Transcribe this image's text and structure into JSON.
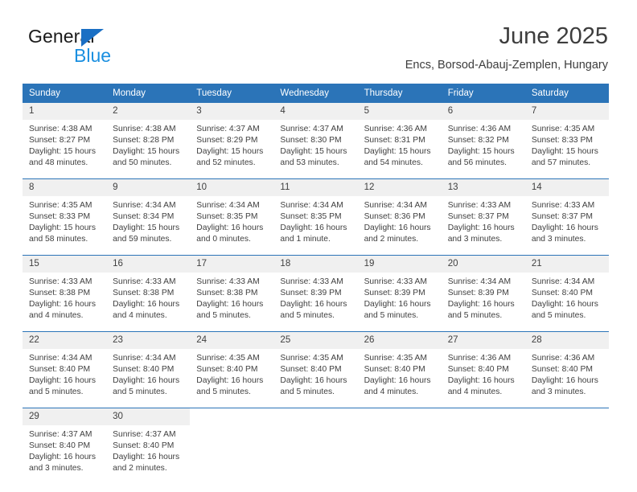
{
  "logo": {
    "text_top": "General",
    "text_bottom": "Blue",
    "triangle_color": "#1a6fc4",
    "blue_color": "#1a8fe0"
  },
  "header": {
    "title": "June 2025",
    "subtitle": "Encs, Borsod-Abauj-Zemplen, Hungary"
  },
  "theme": {
    "header_bg": "#2b74b8",
    "daynum_bg": "#f0f0f0",
    "text": "#404040"
  },
  "calendar": {
    "weekday_headers": [
      "Sunday",
      "Monday",
      "Tuesday",
      "Wednesday",
      "Thursday",
      "Friday",
      "Saturday"
    ],
    "weeks": [
      [
        {
          "day": "1",
          "sunrise": "Sunrise: 4:38 AM",
          "sunset": "Sunset: 8:27 PM",
          "daylight_line1": "Daylight: 15 hours",
          "daylight_line2": "and 48 minutes."
        },
        {
          "day": "2",
          "sunrise": "Sunrise: 4:38 AM",
          "sunset": "Sunset: 8:28 PM",
          "daylight_line1": "Daylight: 15 hours",
          "daylight_line2": "and 50 minutes."
        },
        {
          "day": "3",
          "sunrise": "Sunrise: 4:37 AM",
          "sunset": "Sunset: 8:29 PM",
          "daylight_line1": "Daylight: 15 hours",
          "daylight_line2": "and 52 minutes."
        },
        {
          "day": "4",
          "sunrise": "Sunrise: 4:37 AM",
          "sunset": "Sunset: 8:30 PM",
          "daylight_line1": "Daylight: 15 hours",
          "daylight_line2": "and 53 minutes."
        },
        {
          "day": "5",
          "sunrise": "Sunrise: 4:36 AM",
          "sunset": "Sunset: 8:31 PM",
          "daylight_line1": "Daylight: 15 hours",
          "daylight_line2": "and 54 minutes."
        },
        {
          "day": "6",
          "sunrise": "Sunrise: 4:36 AM",
          "sunset": "Sunset: 8:32 PM",
          "daylight_line1": "Daylight: 15 hours",
          "daylight_line2": "and 56 minutes."
        },
        {
          "day": "7",
          "sunrise": "Sunrise: 4:35 AM",
          "sunset": "Sunset: 8:33 PM",
          "daylight_line1": "Daylight: 15 hours",
          "daylight_line2": "and 57 minutes."
        }
      ],
      [
        {
          "day": "8",
          "sunrise": "Sunrise: 4:35 AM",
          "sunset": "Sunset: 8:33 PM",
          "daylight_line1": "Daylight: 15 hours",
          "daylight_line2": "and 58 minutes."
        },
        {
          "day": "9",
          "sunrise": "Sunrise: 4:34 AM",
          "sunset": "Sunset: 8:34 PM",
          "daylight_line1": "Daylight: 15 hours",
          "daylight_line2": "and 59 minutes."
        },
        {
          "day": "10",
          "sunrise": "Sunrise: 4:34 AM",
          "sunset": "Sunset: 8:35 PM",
          "daylight_line1": "Daylight: 16 hours",
          "daylight_line2": "and 0 minutes."
        },
        {
          "day": "11",
          "sunrise": "Sunrise: 4:34 AM",
          "sunset": "Sunset: 8:35 PM",
          "daylight_line1": "Daylight: 16 hours",
          "daylight_line2": "and 1 minute."
        },
        {
          "day": "12",
          "sunrise": "Sunrise: 4:34 AM",
          "sunset": "Sunset: 8:36 PM",
          "daylight_line1": "Daylight: 16 hours",
          "daylight_line2": "and 2 minutes."
        },
        {
          "day": "13",
          "sunrise": "Sunrise: 4:33 AM",
          "sunset": "Sunset: 8:37 PM",
          "daylight_line1": "Daylight: 16 hours",
          "daylight_line2": "and 3 minutes."
        },
        {
          "day": "14",
          "sunrise": "Sunrise: 4:33 AM",
          "sunset": "Sunset: 8:37 PM",
          "daylight_line1": "Daylight: 16 hours",
          "daylight_line2": "and 3 minutes."
        }
      ],
      [
        {
          "day": "15",
          "sunrise": "Sunrise: 4:33 AM",
          "sunset": "Sunset: 8:38 PM",
          "daylight_line1": "Daylight: 16 hours",
          "daylight_line2": "and 4 minutes."
        },
        {
          "day": "16",
          "sunrise": "Sunrise: 4:33 AM",
          "sunset": "Sunset: 8:38 PM",
          "daylight_line1": "Daylight: 16 hours",
          "daylight_line2": "and 4 minutes."
        },
        {
          "day": "17",
          "sunrise": "Sunrise: 4:33 AM",
          "sunset": "Sunset: 8:38 PM",
          "daylight_line1": "Daylight: 16 hours",
          "daylight_line2": "and 5 minutes."
        },
        {
          "day": "18",
          "sunrise": "Sunrise: 4:33 AM",
          "sunset": "Sunset: 8:39 PM",
          "daylight_line1": "Daylight: 16 hours",
          "daylight_line2": "and 5 minutes."
        },
        {
          "day": "19",
          "sunrise": "Sunrise: 4:33 AM",
          "sunset": "Sunset: 8:39 PM",
          "daylight_line1": "Daylight: 16 hours",
          "daylight_line2": "and 5 minutes."
        },
        {
          "day": "20",
          "sunrise": "Sunrise: 4:34 AM",
          "sunset": "Sunset: 8:39 PM",
          "daylight_line1": "Daylight: 16 hours",
          "daylight_line2": "and 5 minutes."
        },
        {
          "day": "21",
          "sunrise": "Sunrise: 4:34 AM",
          "sunset": "Sunset: 8:40 PM",
          "daylight_line1": "Daylight: 16 hours",
          "daylight_line2": "and 5 minutes."
        }
      ],
      [
        {
          "day": "22",
          "sunrise": "Sunrise: 4:34 AM",
          "sunset": "Sunset: 8:40 PM",
          "daylight_line1": "Daylight: 16 hours",
          "daylight_line2": "and 5 minutes."
        },
        {
          "day": "23",
          "sunrise": "Sunrise: 4:34 AM",
          "sunset": "Sunset: 8:40 PM",
          "daylight_line1": "Daylight: 16 hours",
          "daylight_line2": "and 5 minutes."
        },
        {
          "day": "24",
          "sunrise": "Sunrise: 4:35 AM",
          "sunset": "Sunset: 8:40 PM",
          "daylight_line1": "Daylight: 16 hours",
          "daylight_line2": "and 5 minutes."
        },
        {
          "day": "25",
          "sunrise": "Sunrise: 4:35 AM",
          "sunset": "Sunset: 8:40 PM",
          "daylight_line1": "Daylight: 16 hours",
          "daylight_line2": "and 5 minutes."
        },
        {
          "day": "26",
          "sunrise": "Sunrise: 4:35 AM",
          "sunset": "Sunset: 8:40 PM",
          "daylight_line1": "Daylight: 16 hours",
          "daylight_line2": "and 4 minutes."
        },
        {
          "day": "27",
          "sunrise": "Sunrise: 4:36 AM",
          "sunset": "Sunset: 8:40 PM",
          "daylight_line1": "Daylight: 16 hours",
          "daylight_line2": "and 4 minutes."
        },
        {
          "day": "28",
          "sunrise": "Sunrise: 4:36 AM",
          "sunset": "Sunset: 8:40 PM",
          "daylight_line1": "Daylight: 16 hours",
          "daylight_line2": "and 3 minutes."
        }
      ],
      [
        {
          "day": "29",
          "sunrise": "Sunrise: 4:37 AM",
          "sunset": "Sunset: 8:40 PM",
          "daylight_line1": "Daylight: 16 hours",
          "daylight_line2": "and 3 minutes."
        },
        {
          "day": "30",
          "sunrise": "Sunrise: 4:37 AM",
          "sunset": "Sunset: 8:40 PM",
          "daylight_line1": "Daylight: 16 hours",
          "daylight_line2": "and 2 minutes."
        },
        {
          "day": "",
          "sunrise": "",
          "sunset": "",
          "daylight_line1": "",
          "daylight_line2": ""
        },
        {
          "day": "",
          "sunrise": "",
          "sunset": "",
          "daylight_line1": "",
          "daylight_line2": ""
        },
        {
          "day": "",
          "sunrise": "",
          "sunset": "",
          "daylight_line1": "",
          "daylight_line2": ""
        },
        {
          "day": "",
          "sunrise": "",
          "sunset": "",
          "daylight_line1": "",
          "daylight_line2": ""
        },
        {
          "day": "",
          "sunrise": "",
          "sunset": "",
          "daylight_line1": "",
          "daylight_line2": ""
        }
      ]
    ]
  }
}
